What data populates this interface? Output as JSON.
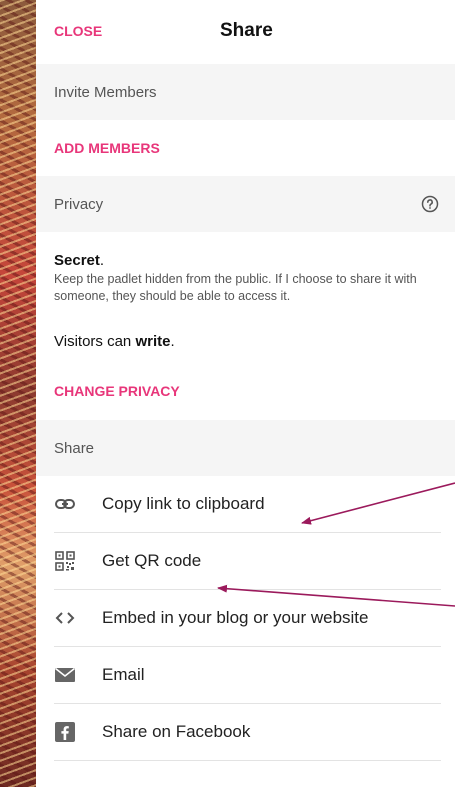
{
  "header": {
    "close_label": "CLOSE",
    "title": "Share"
  },
  "invite": {
    "heading": "Invite Members",
    "add_label": "ADD MEMBERS"
  },
  "privacy": {
    "heading": "Privacy",
    "level": "Secret",
    "level_suffix": ".",
    "description": "Keep the padlet hidden from the public. If I choose to share it with someone, they should be able to access it.",
    "visitors_prefix": "Visitors can ",
    "visitors_perm": "write",
    "visitors_suffix": ".",
    "change_label": "CHANGE PRIVACY"
  },
  "share": {
    "heading": "Share",
    "options": [
      {
        "label": "Copy link to clipboard",
        "icon": "link-icon"
      },
      {
        "label": "Get QR code",
        "icon": "qr-code-icon"
      },
      {
        "label": "Embed in your blog or your website",
        "icon": "code-icon"
      },
      {
        "label": "Email",
        "icon": "email-icon"
      },
      {
        "label": "Share on Facebook",
        "icon": "facebook-icon"
      }
    ]
  },
  "colors": {
    "accent": "#e8367a",
    "annotation_arrow": "#9b1a5c"
  }
}
